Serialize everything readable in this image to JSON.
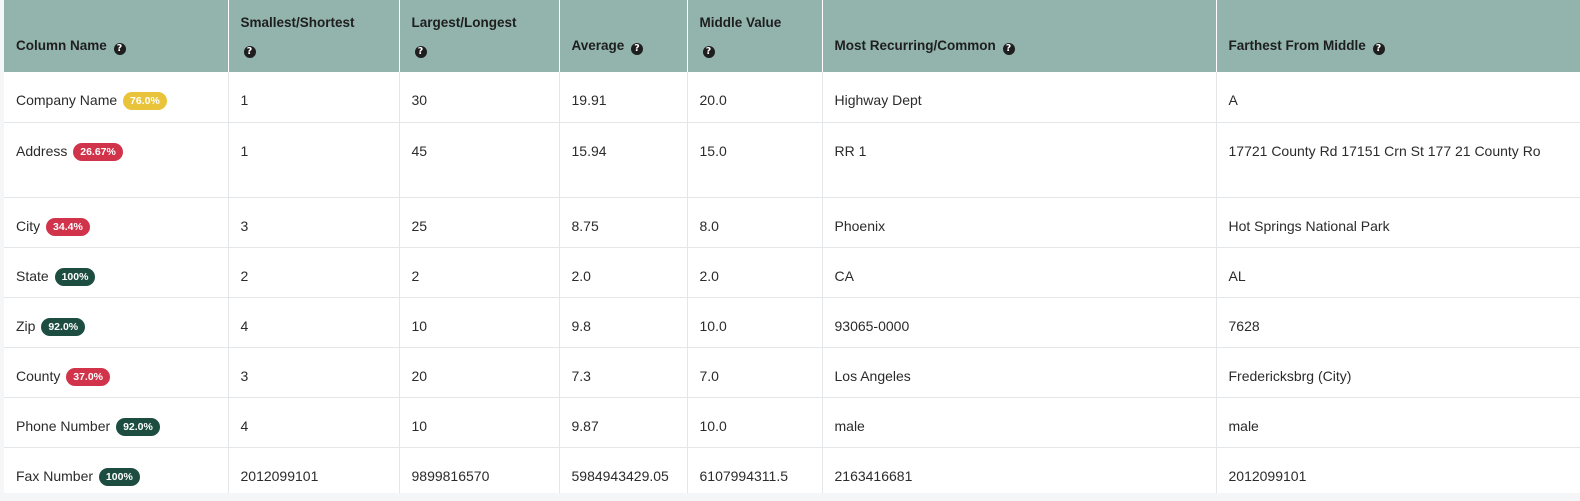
{
  "headers": [
    {
      "label": "Column Name",
      "help": "?"
    },
    {
      "label": "Smallest/Shortest",
      "help": "?"
    },
    {
      "label": "Largest/Longest",
      "help": "?"
    },
    {
      "label": "Average",
      "help": "?"
    },
    {
      "label": "Middle Value",
      "help": "?"
    },
    {
      "label": "Most Recurring/Common",
      "help": "?"
    },
    {
      "label": "Farthest From Middle",
      "help": "?"
    }
  ],
  "rows": [
    {
      "name": "Company Name",
      "badge": "76.0%",
      "badge_status": "warn",
      "smallest": "1",
      "largest": "30",
      "average": "19.91",
      "middle": "20.0",
      "common": "Highway Dept",
      "farthest": "A"
    },
    {
      "name": "Address",
      "badge": "26.67%",
      "badge_status": "bad",
      "smallest": "1",
      "largest": "45",
      "average": "15.94",
      "middle": "15.0",
      "common": "RR 1",
      "farthest": "17721 County Rd 17151 Crn St 177 21 County Ro"
    },
    {
      "name": "City",
      "badge": "34.4%",
      "badge_status": "bad",
      "smallest": "3",
      "largest": "25",
      "average": "8.75",
      "middle": "8.0",
      "common": "Phoenix",
      "farthest": "Hot Springs National Park"
    },
    {
      "name": "State",
      "badge": "100%",
      "badge_status": "good",
      "smallest": "2",
      "largest": "2",
      "average": "2.0",
      "middle": "2.0",
      "common": "CA",
      "farthest": "AL"
    },
    {
      "name": "Zip",
      "badge": "92.0%",
      "badge_status": "good",
      "smallest": "4",
      "largest": "10",
      "average": "9.8",
      "middle": "10.0",
      "common": "93065-0000",
      "farthest": "7628"
    },
    {
      "name": "County",
      "badge": "37.0%",
      "badge_status": "bad",
      "smallest": "3",
      "largest": "20",
      "average": "7.3",
      "middle": "7.0",
      "common": "Los Angeles",
      "farthest": "Fredericksbrg (City)"
    },
    {
      "name": "Phone Number",
      "badge": "92.0%",
      "badge_status": "good",
      "smallest": "4",
      "largest": "10",
      "average": "9.87",
      "middle": "10.0",
      "common": "male",
      "farthest": "male"
    },
    {
      "name": "Fax Number",
      "badge": "100%",
      "badge_status": "good",
      "smallest": "2012099101",
      "largest": "9899816570",
      "average": "5984943429.05",
      "middle": "6107994311.5",
      "common": "2163416681",
      "farthest": "2012099101"
    }
  ],
  "colors": {
    "header_bg": "#92b4ad",
    "badge_warn": "#e9c43a",
    "badge_bad": "#d1334a",
    "badge_good": "#1d4d40"
  }
}
